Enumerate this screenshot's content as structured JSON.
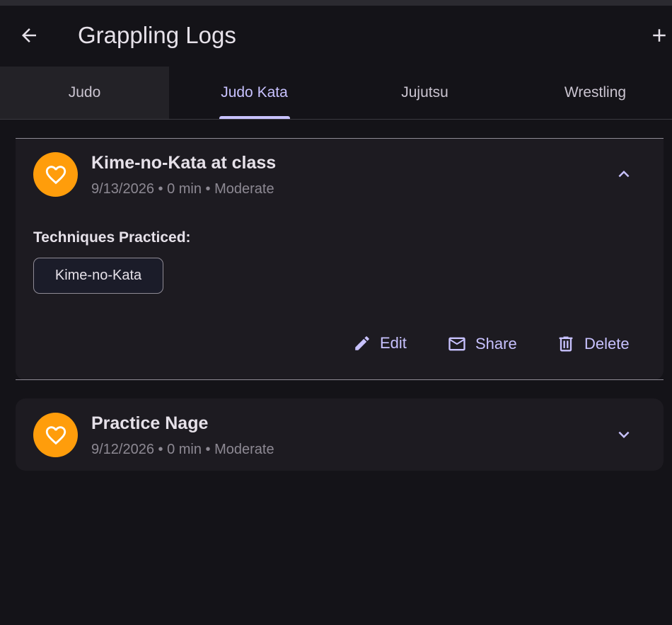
{
  "app_bar": {
    "title": "Grappling Logs",
    "back_icon": "arrow-left-icon",
    "add_icon": "plus-icon"
  },
  "tabs": [
    {
      "label": "Judo",
      "active": false
    },
    {
      "label": "Judo Kata",
      "active": true
    },
    {
      "label": "Jujutsu",
      "active": false
    },
    {
      "label": "Wrestling",
      "active": false
    }
  ],
  "entries": [
    {
      "title": "Kime-no-Kata at class",
      "meta": "9/13/2026 • 0 min • Moderate",
      "icon": "heart-icon",
      "expanded": true,
      "section_label": "Techniques Practiced:",
      "techniques": [
        "Kime-no-Kata"
      ],
      "actions": {
        "edit": "Edit",
        "share": "Share",
        "delete": "Delete"
      }
    },
    {
      "title": "Practice Nage",
      "meta": "9/12/2026 • 0 min • Moderate",
      "icon": "heart-icon",
      "expanded": false
    }
  ],
  "colors": {
    "background": "#141318",
    "surface": "#1d1b21",
    "accent": "#c8c2ff",
    "avatar": "#ff9d0b",
    "muted_text": "#8d8993"
  }
}
